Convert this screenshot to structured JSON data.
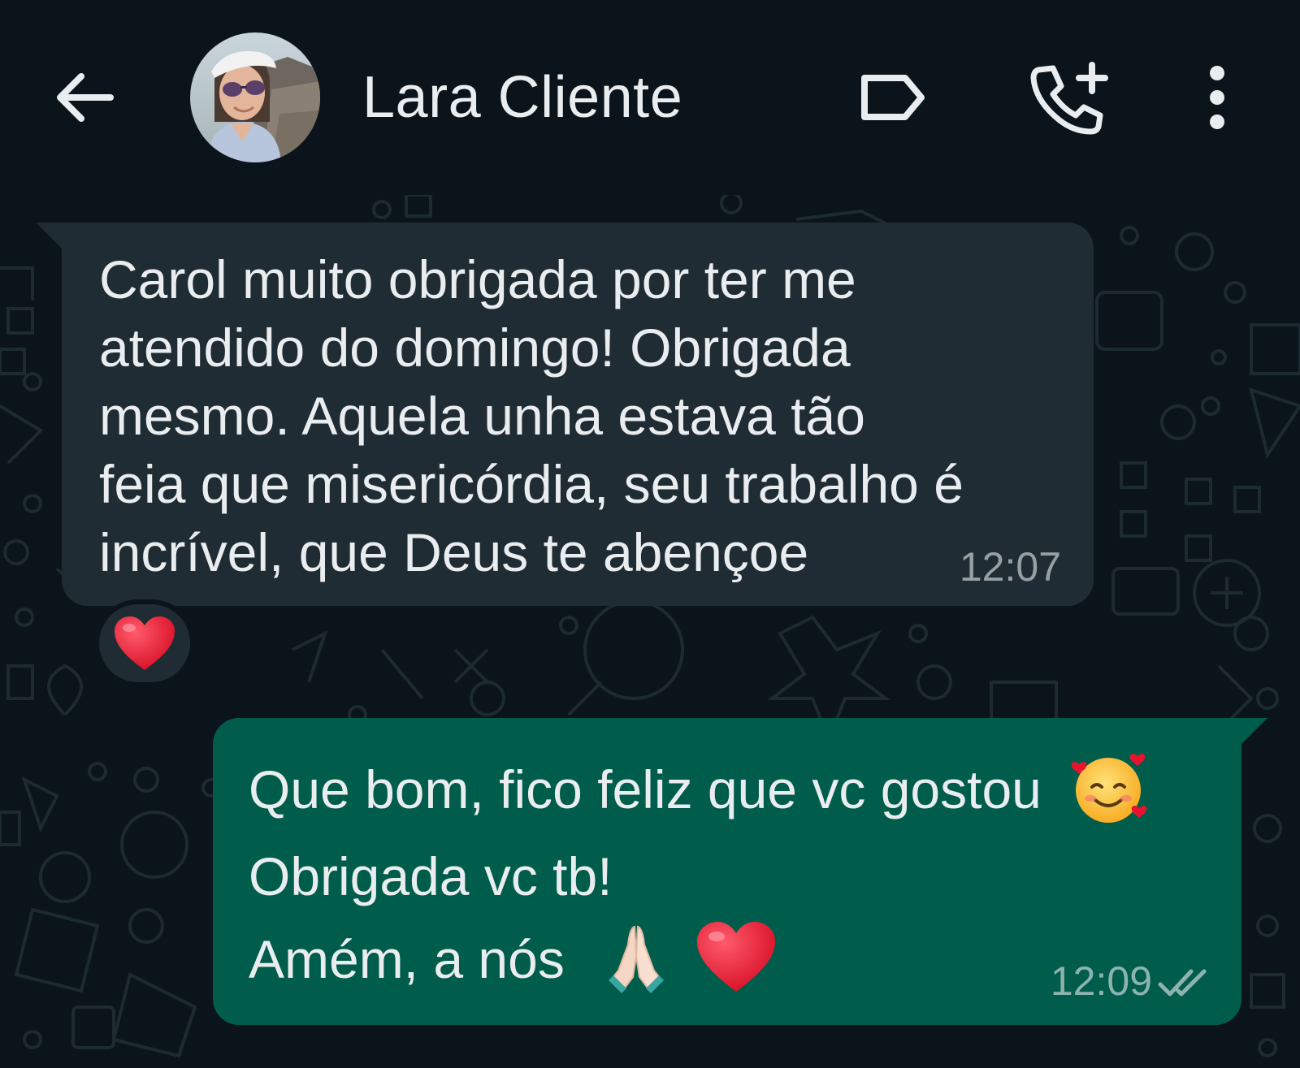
{
  "header": {
    "contact_name": "Lara Cliente",
    "icons": [
      "back-arrow-icon",
      "avatar",
      "label-tag-icon",
      "add-call-icon",
      "more-vert-icon"
    ]
  },
  "messages": [
    {
      "direction": "incoming",
      "lines": [
        "Carol muito obrigada por ter me",
        "atendido do domingo!  Obrigada",
        "mesmo. Aquela unha estava tão",
        "feia que misericórdia, seu trabalho é",
        "incrível, que Deus te abençoe"
      ],
      "time": "12:07",
      "reaction": "heart-emoji"
    },
    {
      "direction": "outgoing",
      "lines": [
        "Que bom, fico feliz que vc gostou",
        "Obrigada vc tb!",
        "Amém, a nós"
      ],
      "emojis": [
        "smiling-face-with-hearts-emoji",
        "folded-hands-emoji",
        "red-heart-emoji"
      ],
      "time": "12:09",
      "status": "read-double-check"
    }
  ],
  "colors": {
    "background": "#0b141a",
    "incoming_bubble": "#202c33",
    "outgoing_bubble": "#005c4b",
    "text": "#e9edef",
    "heart": "#e0102a"
  }
}
